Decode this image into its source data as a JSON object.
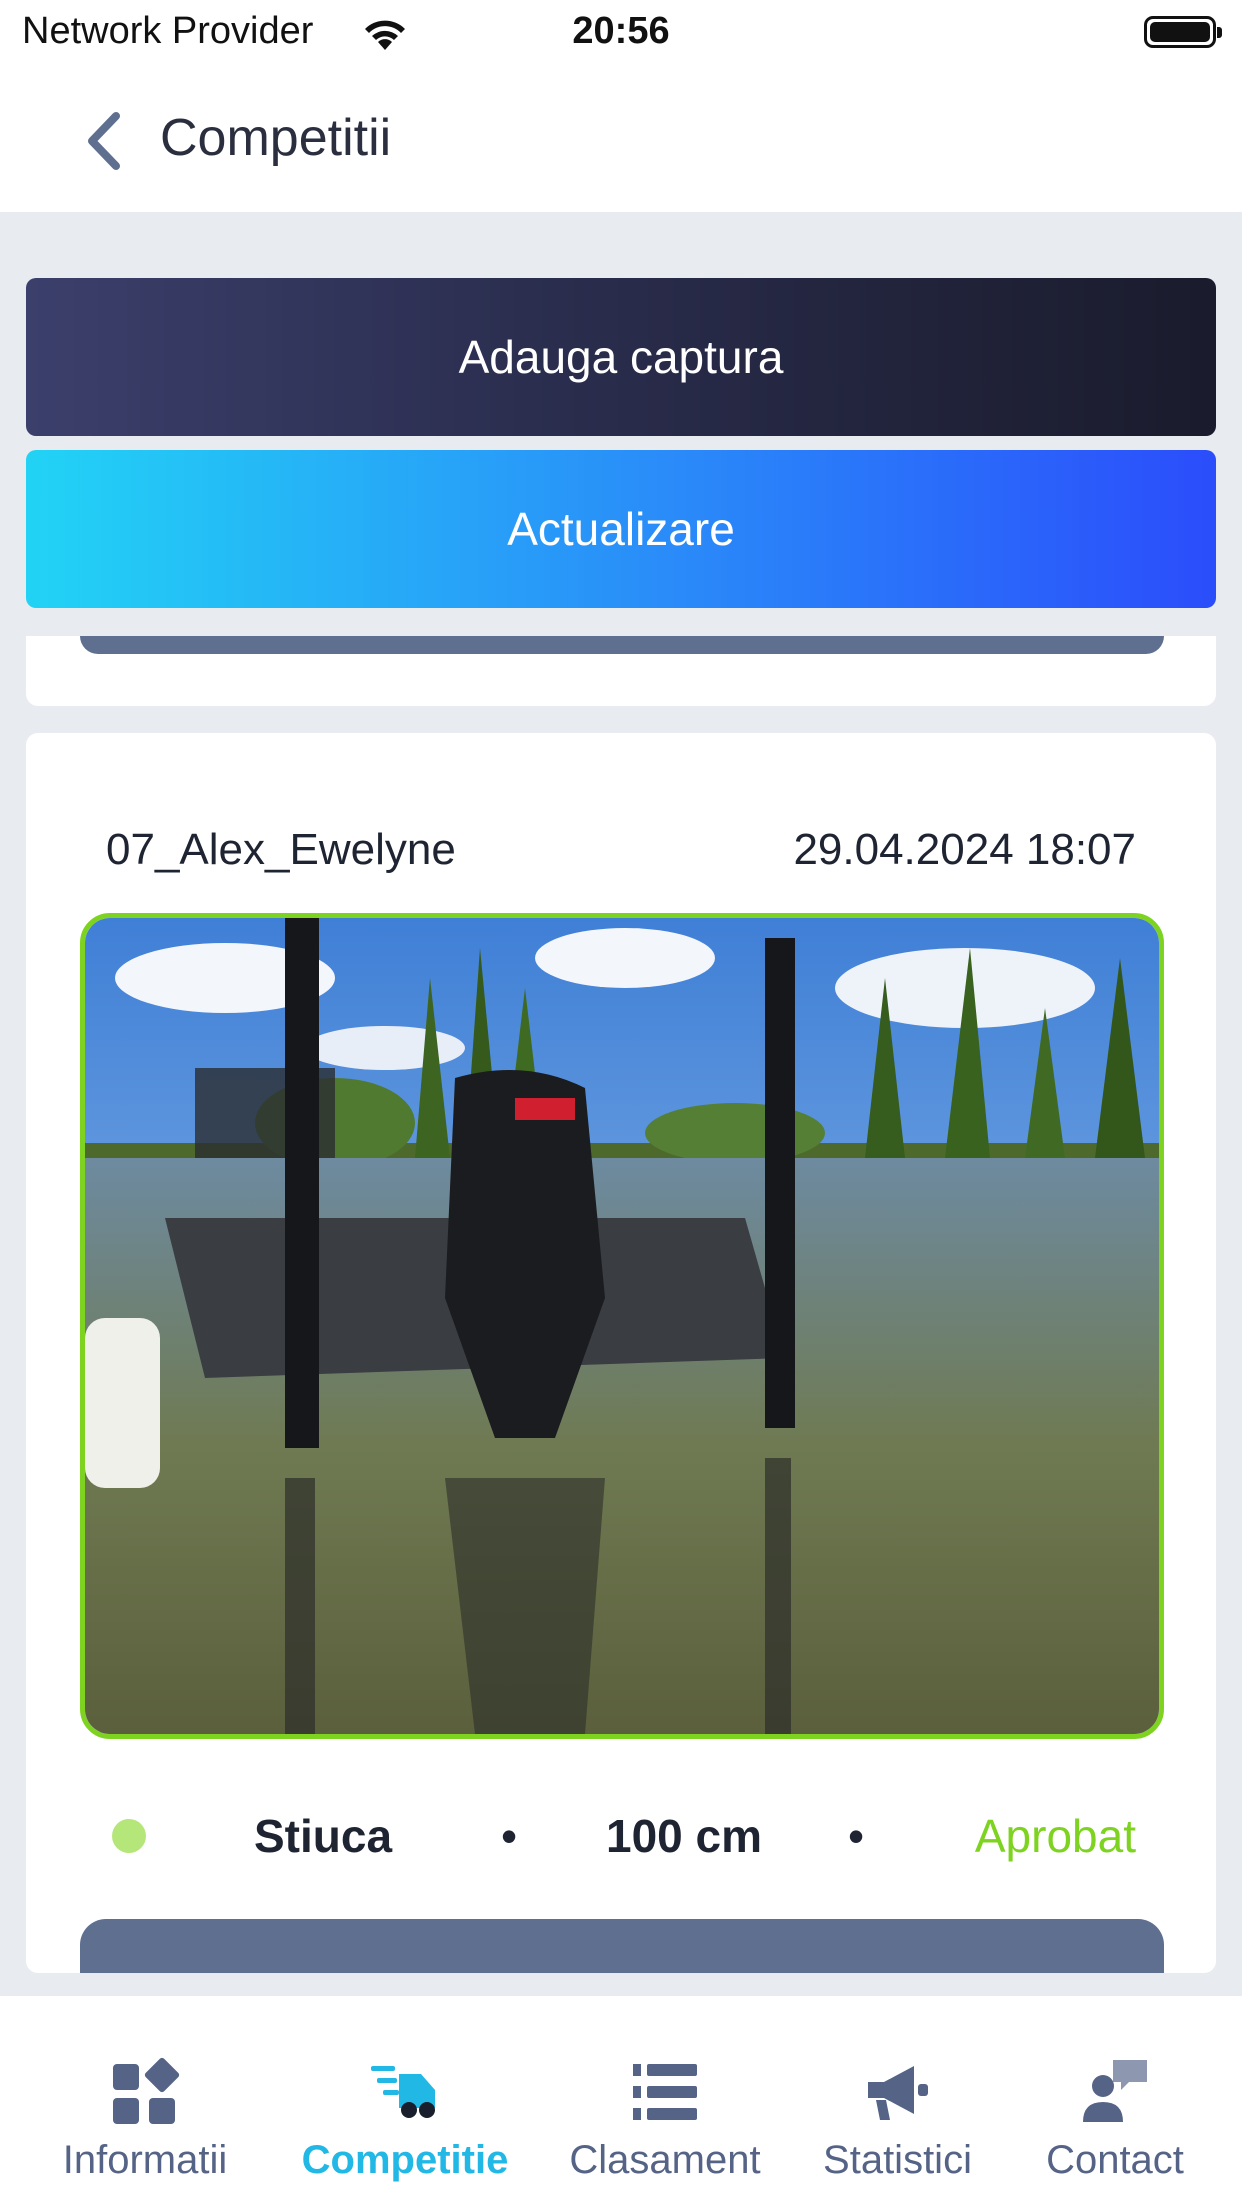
{
  "status_bar": {
    "carrier": "Network Provider",
    "time": "20:56"
  },
  "nav": {
    "title": "Competitii",
    "back_icon": "chevron-left-icon"
  },
  "actions": {
    "add_label": "Adauga captura",
    "update_label": "Actualizare"
  },
  "catch_card": {
    "team": "07_Alex_Ewelyne",
    "datetime": "29.04.2024 18:07",
    "species": "Stiuca",
    "separator": "•",
    "length": "100 cm",
    "status": "Aprobat",
    "status_color": "#7ed321"
  },
  "tabs": [
    {
      "label": "Informatii",
      "icon": "dashboard-icon",
      "active": false
    },
    {
      "label": "Competitie",
      "icon": "delivery-truck-icon",
      "active": true
    },
    {
      "label": "Clasament",
      "icon": "list-icon",
      "active": false
    },
    {
      "label": "Statistici",
      "icon": "megaphone-icon",
      "active": false
    },
    {
      "label": "Contact",
      "icon": "contact-chat-icon",
      "active": false
    }
  ],
  "colors": {
    "accent": "#22b8e6",
    "tab_inactive": "#556486",
    "approved": "#7ed321"
  }
}
